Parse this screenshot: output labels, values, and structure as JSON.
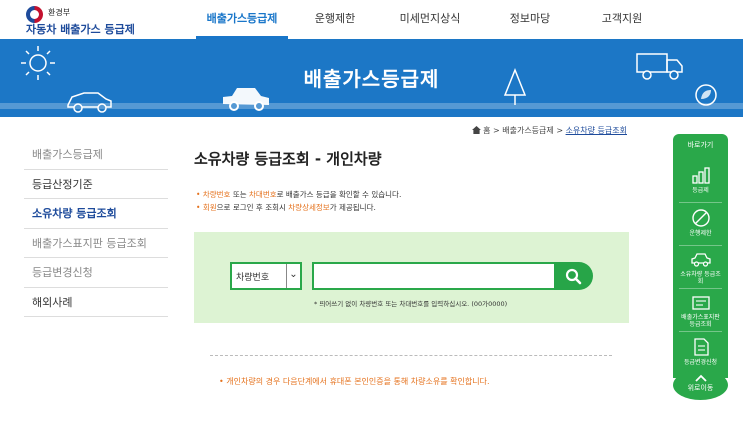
{
  "header": {
    "ministry": "환경부",
    "site_title": "자동차 배출가스 등급제",
    "nav": [
      {
        "label": "배출가스등급제",
        "active": true
      },
      {
        "label": "운행제한",
        "active": false
      },
      {
        "label": "미세먼지상식",
        "active": false
      },
      {
        "label": "정보마당",
        "active": false
      },
      {
        "label": "고객지원",
        "active": false
      }
    ]
  },
  "banner": {
    "title": "배출가스등급제"
  },
  "breadcrumb": {
    "home": "홈",
    "parent": "배출가스등급제",
    "current": "소유차량 등급조회"
  },
  "sidebar": {
    "items": [
      {
        "label": "배출가스등급제"
      },
      {
        "label": "등급산정기준"
      },
      {
        "label": "소유차량 등급조회"
      },
      {
        "label": "배출가스표지판 등급조회"
      },
      {
        "label": "등급변경신청"
      },
      {
        "label": "해외사례"
      }
    ]
  },
  "main": {
    "title": "소유차량 등급조회 - 개인차량",
    "note1": {
      "hl1": "차량번호",
      "t1": " 또는 ",
      "hl2": "차대번호",
      "t2": "로 배출가스 등급을 확인할 수 있습니다."
    },
    "note2": {
      "hl1": "회원",
      "t1": "으로 로그인 후 조회시 ",
      "hl2": "차량상세정보",
      "t2": "가 제공됩니다."
    },
    "search": {
      "select_value": "차량번호",
      "input_value": "",
      "input_placeholder": "",
      "help": "* 띄어쓰기 없이 차량번호 또는 차대번호를 입력하십시오. (00가0000)"
    },
    "cert_note": "• 개인차량의 경우 다음단계에서 휴대폰 본인인증을 통해 차량소유를 확인합니다."
  },
  "quick_menu": {
    "title": "바로가기",
    "items": [
      {
        "label": "등급제",
        "icon": "bar-chart-icon"
      },
      {
        "label": "운행제한",
        "icon": "prohibit-icon"
      },
      {
        "label": "소유차량 등급조회",
        "icon": "car-icon"
      },
      {
        "label": "배출가스표지판 등급조회",
        "icon": "sign-icon"
      },
      {
        "label": "등급변경신청",
        "icon": "document-icon"
      }
    ],
    "top_label": "위로이동"
  },
  "colors": {
    "brand_blue": "#1c77c6",
    "accent_green": "#2aa84a",
    "highlight_orange": "#e5721d",
    "search_bg": "#ddf3d3"
  }
}
